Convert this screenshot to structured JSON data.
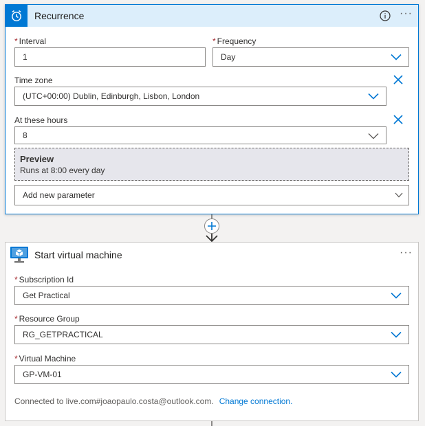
{
  "recurrence": {
    "title": "Recurrence",
    "interval": {
      "label": "Interval",
      "value": "1"
    },
    "frequency": {
      "label": "Frequency",
      "value": "Day"
    },
    "time_zone": {
      "label": "Time zone",
      "value": "(UTC+00:00) Dublin, Edinburgh, Lisbon, London"
    },
    "hours": {
      "label": "At these hours",
      "value": "8"
    },
    "preview": {
      "title": "Preview",
      "text": "Runs at 8:00 every day"
    },
    "add_param": "Add new parameter",
    "more": "···"
  },
  "vm": {
    "title": "Start virtual machine",
    "subscription": {
      "label": "Subscription Id",
      "value": "Get Practical"
    },
    "resource_group": {
      "label": "Resource Group",
      "value": "RG_GETPRACTICAL"
    },
    "virtual_machine": {
      "label": "Virtual Machine",
      "value": "GP-VM-01"
    },
    "connected_text": "Connected to live.com#joaopaulo.costa@outlook.com.",
    "change_link": "Change connection.",
    "more": "···"
  },
  "required_mark": "*",
  "colors": {
    "accent": "#0078d4",
    "header_bg": "#dceefb",
    "preview_bg": "#e6e6ec",
    "required": "#a4262c"
  },
  "icons": {
    "recurrence": "alarm-clock-icon",
    "info": "info-icon",
    "vm": "virtual-machine-icon",
    "chevron": "chevron-down-icon",
    "remove": "close-icon",
    "add": "plus-icon"
  }
}
